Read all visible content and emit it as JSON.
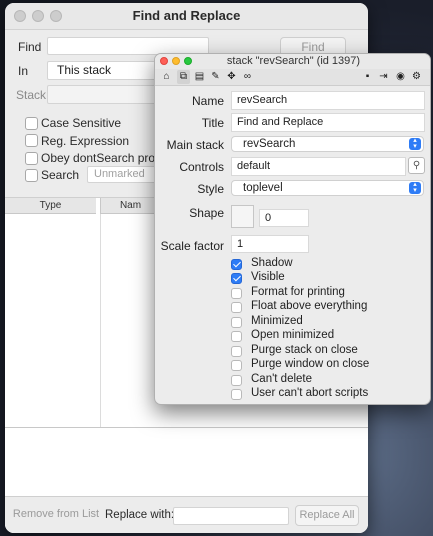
{
  "find_replace": {
    "title": "Find and Replace",
    "find_label": "Find",
    "find_value": "",
    "find_button": "Find",
    "in_label": "In",
    "in_value": "This stack",
    "stack_label": "Stack",
    "options": [
      {
        "label": "Case Sensitive",
        "checked": false
      },
      {
        "label": "Reg. Expression",
        "checked": false
      },
      {
        "label": "Obey dontSearch prope",
        "checked": false
      },
      {
        "label": "Search",
        "checked": false
      }
    ],
    "search_scope_value": "Unmarked",
    "columns": {
      "type": "Type",
      "name": "Nam"
    },
    "remove_button": "Remove from List",
    "replace_label": "Replace with:",
    "replace_value": "",
    "replace_all_button": "Replace All"
  },
  "inspector": {
    "title": "stack \"revSearch\" (id 1397)",
    "toolbar_icons": [
      "home-icon",
      "copy-icon",
      "stack-icon",
      "pencil-icon",
      "move-icon",
      "link-icon",
      "lock-icon",
      "login-icon",
      "record-icon",
      "gear-icon"
    ],
    "fields": {
      "name_label": "Name",
      "name_value": "revSearch",
      "title_label": "Title",
      "title_value": "Find and Replace",
      "mainstack_label": "Main stack",
      "mainstack_value": "revSearch",
      "controls_label": "Controls",
      "controls_value": "default",
      "style_label": "Style",
      "style_value": "toplevel",
      "shape_label": "Shape",
      "shape_value": "0",
      "scale_label": "Scale factor",
      "scale_value": "1"
    },
    "checkboxes": [
      {
        "label": "Shadow",
        "checked": true
      },
      {
        "label": "Visible",
        "checked": true
      },
      {
        "label": "Format for printing",
        "checked": false
      },
      {
        "label": "Float above everything",
        "checked": false
      },
      {
        "label": "Minimized",
        "checked": false
      },
      {
        "label": "Open minimized",
        "checked": false
      },
      {
        "label": "Purge stack on close",
        "checked": false
      },
      {
        "label": "Purge window on close",
        "checked": false
      },
      {
        "label": "Can't delete",
        "checked": false
      },
      {
        "label": "User can't abort scripts",
        "checked": false
      }
    ],
    "colors": {
      "accent": "#2d7cf6",
      "close": "#fe5f57",
      "minimize": "#febc2e",
      "zoom": "#28c840"
    }
  }
}
